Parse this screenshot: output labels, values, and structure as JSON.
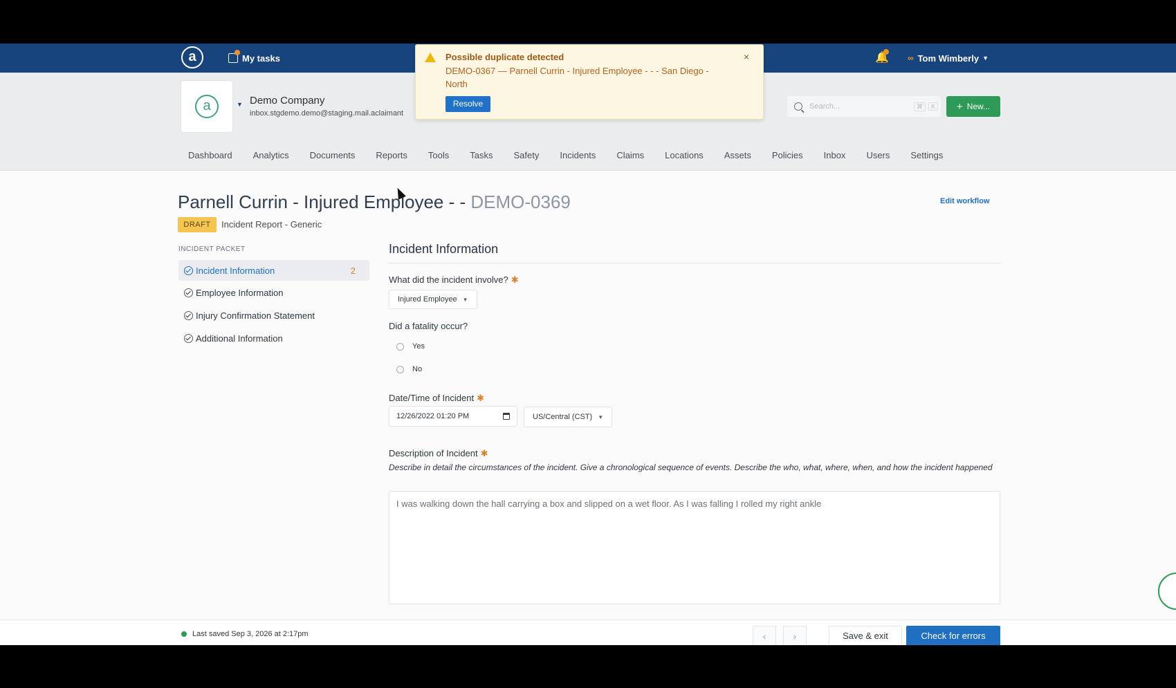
{
  "topbar": {
    "logo_glyph": "a",
    "my_tasks": "My tasks",
    "user_name": "Tom Wimberly",
    "accent": "#17447d",
    "badge_color": "#e9932b"
  },
  "company": {
    "logo_glyph": "a",
    "name": "Demo Company",
    "email": "inbox.stgdemo.demo@staging.mail.aclaimant"
  },
  "search": {
    "placeholder": "Search...",
    "shortcut_1": "⌘",
    "shortcut_2": "K"
  },
  "new_button": "New...",
  "nav": [
    "Dashboard",
    "Analytics",
    "Documents",
    "Reports",
    "Tools",
    "Tasks",
    "Safety",
    "Incidents",
    "Claims",
    "Locations",
    "Assets",
    "Policies",
    "Inbox",
    "Users",
    "Settings"
  ],
  "toast": {
    "title": "Possible duplicate detected",
    "body": "DEMO-0367 — Parnell Currin - Injured Employee - - - San Diego - North",
    "resolve": "Resolve",
    "close": "×"
  },
  "page": {
    "title": "Parnell Currin - Injured Employee - -",
    "id": "DEMO-0369",
    "status": "DRAFT",
    "subtype": "Incident Report - Generic",
    "edit_workflow": "Edit workflow"
  },
  "sidebar": {
    "label": "INCIDENT PACKET",
    "items": [
      {
        "label": "Incident Information",
        "count": "2"
      },
      {
        "label": "Employee Information"
      },
      {
        "label": "Injury Confirmation Statement"
      },
      {
        "label": "Additional Information"
      }
    ]
  },
  "form": {
    "section": "Incident Information",
    "involve_label": "What did the incident involve?",
    "involve_value": "Injured Employee",
    "fatality_label": "Did a fatality occur?",
    "fatality_options": [
      "Yes",
      "No"
    ],
    "datetime_label": "Date/Time of Incident",
    "datetime_value": "12/26/2022  01:20 PM",
    "timezone_value": "US/Central (CST)",
    "description_label": "Description of Incident",
    "description_hint": "Describe in detail the circumstances of the incident. Give a chronological sequence of events. Describe the who, what, where, when, and how the incident happened",
    "description_value": "I was walking down the hall carrying a box and slipped on a wet floor.  As I was falling I rolled my right ankle",
    "required_mark": "✱"
  },
  "footer": {
    "last_saved": "Last saved Sep 3, 2026 at 2:17pm",
    "prev": "‹",
    "next": "›",
    "save_exit": "Save & exit",
    "check_errors": "Check for errors"
  }
}
